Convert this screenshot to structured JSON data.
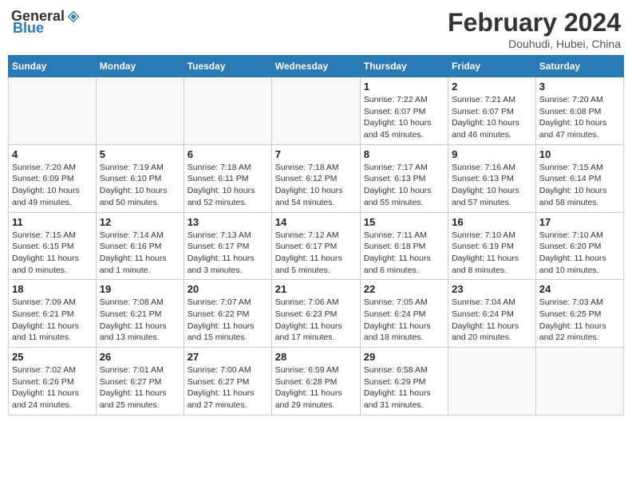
{
  "header": {
    "logo_general": "General",
    "logo_blue": "Blue",
    "main_title": "February 2024",
    "sub_title": "Douhudi, Hubei, China"
  },
  "days_of_week": [
    "Sunday",
    "Monday",
    "Tuesday",
    "Wednesday",
    "Thursday",
    "Friday",
    "Saturday"
  ],
  "weeks": [
    [
      {
        "day": "",
        "sunrise": "",
        "sunset": "",
        "daylight": ""
      },
      {
        "day": "",
        "sunrise": "",
        "sunset": "",
        "daylight": ""
      },
      {
        "day": "",
        "sunrise": "",
        "sunset": "",
        "daylight": ""
      },
      {
        "day": "",
        "sunrise": "",
        "sunset": "",
        "daylight": ""
      },
      {
        "day": "1",
        "sunrise": "Sunrise: 7:22 AM",
        "sunset": "Sunset: 6:07 PM",
        "daylight": "Daylight: 10 hours and 45 minutes."
      },
      {
        "day": "2",
        "sunrise": "Sunrise: 7:21 AM",
        "sunset": "Sunset: 6:07 PM",
        "daylight": "Daylight: 10 hours and 46 minutes."
      },
      {
        "day": "3",
        "sunrise": "Sunrise: 7:20 AM",
        "sunset": "Sunset: 6:08 PM",
        "daylight": "Daylight: 10 hours and 47 minutes."
      }
    ],
    [
      {
        "day": "4",
        "sunrise": "Sunrise: 7:20 AM",
        "sunset": "Sunset: 6:09 PM",
        "daylight": "Daylight: 10 hours and 49 minutes."
      },
      {
        "day": "5",
        "sunrise": "Sunrise: 7:19 AM",
        "sunset": "Sunset: 6:10 PM",
        "daylight": "Daylight: 10 hours and 50 minutes."
      },
      {
        "day": "6",
        "sunrise": "Sunrise: 7:18 AM",
        "sunset": "Sunset: 6:11 PM",
        "daylight": "Daylight: 10 hours and 52 minutes."
      },
      {
        "day": "7",
        "sunrise": "Sunrise: 7:18 AM",
        "sunset": "Sunset: 6:12 PM",
        "daylight": "Daylight: 10 hours and 54 minutes."
      },
      {
        "day": "8",
        "sunrise": "Sunrise: 7:17 AM",
        "sunset": "Sunset: 6:13 PM",
        "daylight": "Daylight: 10 hours and 55 minutes."
      },
      {
        "day": "9",
        "sunrise": "Sunrise: 7:16 AM",
        "sunset": "Sunset: 6:13 PM",
        "daylight": "Daylight: 10 hours and 57 minutes."
      },
      {
        "day": "10",
        "sunrise": "Sunrise: 7:15 AM",
        "sunset": "Sunset: 6:14 PM",
        "daylight": "Daylight: 10 hours and 58 minutes."
      }
    ],
    [
      {
        "day": "11",
        "sunrise": "Sunrise: 7:15 AM",
        "sunset": "Sunset: 6:15 PM",
        "daylight": "Daylight: 11 hours and 0 minutes."
      },
      {
        "day": "12",
        "sunrise": "Sunrise: 7:14 AM",
        "sunset": "Sunset: 6:16 PM",
        "daylight": "Daylight: 11 hours and 1 minute."
      },
      {
        "day": "13",
        "sunrise": "Sunrise: 7:13 AM",
        "sunset": "Sunset: 6:17 PM",
        "daylight": "Daylight: 11 hours and 3 minutes."
      },
      {
        "day": "14",
        "sunrise": "Sunrise: 7:12 AM",
        "sunset": "Sunset: 6:17 PM",
        "daylight": "Daylight: 11 hours and 5 minutes."
      },
      {
        "day": "15",
        "sunrise": "Sunrise: 7:11 AM",
        "sunset": "Sunset: 6:18 PM",
        "daylight": "Daylight: 11 hours and 6 minutes."
      },
      {
        "day": "16",
        "sunrise": "Sunrise: 7:10 AM",
        "sunset": "Sunset: 6:19 PM",
        "daylight": "Daylight: 11 hours and 8 minutes."
      },
      {
        "day": "17",
        "sunrise": "Sunrise: 7:10 AM",
        "sunset": "Sunset: 6:20 PM",
        "daylight": "Daylight: 11 hours and 10 minutes."
      }
    ],
    [
      {
        "day": "18",
        "sunrise": "Sunrise: 7:09 AM",
        "sunset": "Sunset: 6:21 PM",
        "daylight": "Daylight: 11 hours and 11 minutes."
      },
      {
        "day": "19",
        "sunrise": "Sunrise: 7:08 AM",
        "sunset": "Sunset: 6:21 PM",
        "daylight": "Daylight: 11 hours and 13 minutes."
      },
      {
        "day": "20",
        "sunrise": "Sunrise: 7:07 AM",
        "sunset": "Sunset: 6:22 PM",
        "daylight": "Daylight: 11 hours and 15 minutes."
      },
      {
        "day": "21",
        "sunrise": "Sunrise: 7:06 AM",
        "sunset": "Sunset: 6:23 PM",
        "daylight": "Daylight: 11 hours and 17 minutes."
      },
      {
        "day": "22",
        "sunrise": "Sunrise: 7:05 AM",
        "sunset": "Sunset: 6:24 PM",
        "daylight": "Daylight: 11 hours and 18 minutes."
      },
      {
        "day": "23",
        "sunrise": "Sunrise: 7:04 AM",
        "sunset": "Sunset: 6:24 PM",
        "daylight": "Daylight: 11 hours and 20 minutes."
      },
      {
        "day": "24",
        "sunrise": "Sunrise: 7:03 AM",
        "sunset": "Sunset: 6:25 PM",
        "daylight": "Daylight: 11 hours and 22 minutes."
      }
    ],
    [
      {
        "day": "25",
        "sunrise": "Sunrise: 7:02 AM",
        "sunset": "Sunset: 6:26 PM",
        "daylight": "Daylight: 11 hours and 24 minutes."
      },
      {
        "day": "26",
        "sunrise": "Sunrise: 7:01 AM",
        "sunset": "Sunset: 6:27 PM",
        "daylight": "Daylight: 11 hours and 25 minutes."
      },
      {
        "day": "27",
        "sunrise": "Sunrise: 7:00 AM",
        "sunset": "Sunset: 6:27 PM",
        "daylight": "Daylight: 11 hours and 27 minutes."
      },
      {
        "day": "28",
        "sunrise": "Sunrise: 6:59 AM",
        "sunset": "Sunset: 6:28 PM",
        "daylight": "Daylight: 11 hours and 29 minutes."
      },
      {
        "day": "29",
        "sunrise": "Sunrise: 6:58 AM",
        "sunset": "Sunset: 6:29 PM",
        "daylight": "Daylight: 11 hours and 31 minutes."
      },
      {
        "day": "",
        "sunrise": "",
        "sunset": "",
        "daylight": ""
      },
      {
        "day": "",
        "sunrise": "",
        "sunset": "",
        "daylight": ""
      }
    ]
  ]
}
